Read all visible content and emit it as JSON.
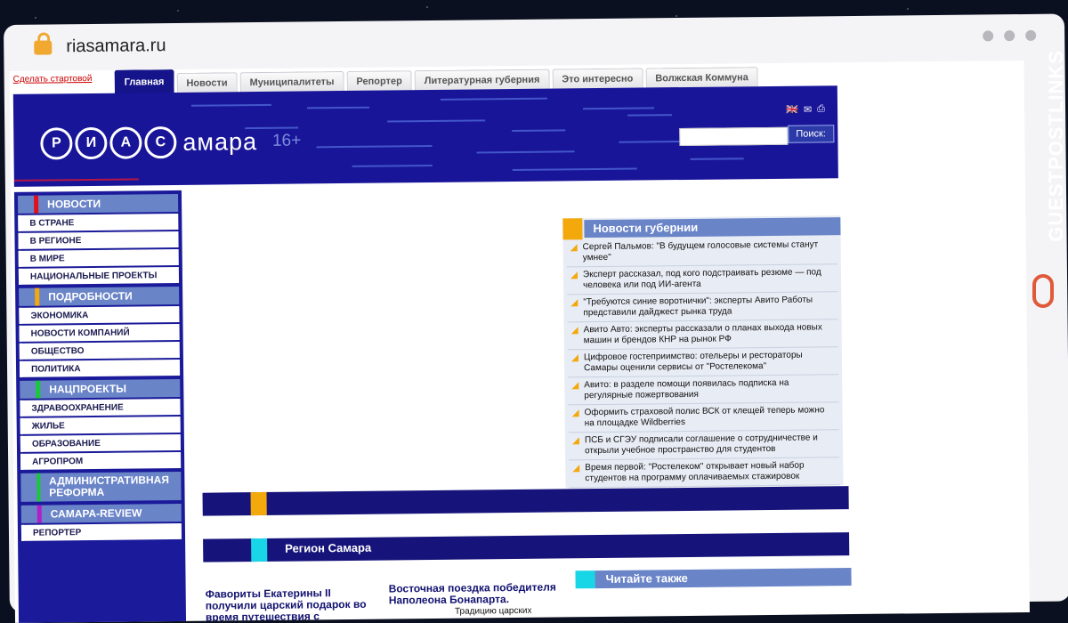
{
  "browser": {
    "url": "riasamara.ru"
  },
  "watermark": {
    "text": "GUESTPOSTLINKS"
  },
  "site": {
    "make_start": "Сделать стартовой",
    "tabs": [
      "Главная",
      "Новости",
      "Муниципалитеты",
      "Репортер",
      "Литературная губерния",
      "Это интересно",
      "Волжская Коммуна"
    ],
    "logo_letters": [
      "Р",
      "И",
      "А",
      "С"
    ],
    "logo_text": "амара",
    "age": "16+",
    "search_button": "Поиск:",
    "lang_icons": [
      "uk-flag-icon",
      "mail-icon",
      "print-icon"
    ]
  },
  "sidebar": {
    "sections": [
      {
        "label": "НОВОСТИ",
        "color": "#e0101c",
        "items": [
          "В СТРАНЕ",
          "В РЕГИОНЕ",
          "В МИРЕ",
          "НАЦИОНАЛЬНЫЕ ПРОЕКТЫ"
        ]
      },
      {
        "label": "ПОДРОБНОСТИ",
        "color": "#f3a80c",
        "items": [
          "ЭКОНОМИКА",
          "НОВОСТИ КОМПАНИЙ",
          "ОБЩЕСТВО",
          "ПОЛИТИКА"
        ]
      },
      {
        "label": "НАЦПРОЕКТЫ",
        "color": "#18c83a",
        "items": [
          "ЗДРАВООХРАНЕНИЕ",
          "ЖИЛЬЕ",
          "ОБРАЗОВАНИЕ",
          "АГРОПРОМ"
        ]
      },
      {
        "label": "АДМИНИСТРАТИВНАЯ РЕФОРМА",
        "color": "#18c83a",
        "items": []
      },
      {
        "label": "САМАРА-REVIEW",
        "color": "#b020c8",
        "items": [
          "РЕПОРТЕР"
        ]
      }
    ]
  },
  "news_province": {
    "title": "Новости губернии",
    "items": [
      "Сергей Пальмов: \"В будущем голосовые системы станут умнее\"",
      "Эксперт рассказал, под кого подстраивать резюме — под человека или под ИИ-агента",
      "\"Требуются синие воротнички\": эксперты Авито Работы представили дайджест рынка труда",
      "Авито Авто: эксперты рассказали о планах выхода новых машин и брендов КНР на рынок РФ",
      "Цифровое гостеприимство: отельеры и рестораторы Самары оценили сервисы от \"Ростелекома\"",
      "Авито: в разделе помощи появилась подписка на регулярные пожертвования",
      "Оформить страховой полис ВСК от клещей теперь можно на площадке Wildberries",
      "ПСБ и СГЭУ подписали соглашение о сотрудничестве и открыли учебное пространство для студентов",
      "Время первой: \"Ростелеком\" открывает новый набор студентов на программу оплачиваемых стажировок"
    ]
  },
  "region": {
    "title": "Регион Самара"
  },
  "articles": [
    {
      "title": "Фавориты Екатерины II получили царский подарок во время путешествия с императрицей по"
    },
    {
      "title": "Восточная поездка победителя Наполеона Бонапарта.",
      "snippet": "Традицию царских"
    }
  ],
  "read_also": {
    "title": "Читайте также"
  }
}
